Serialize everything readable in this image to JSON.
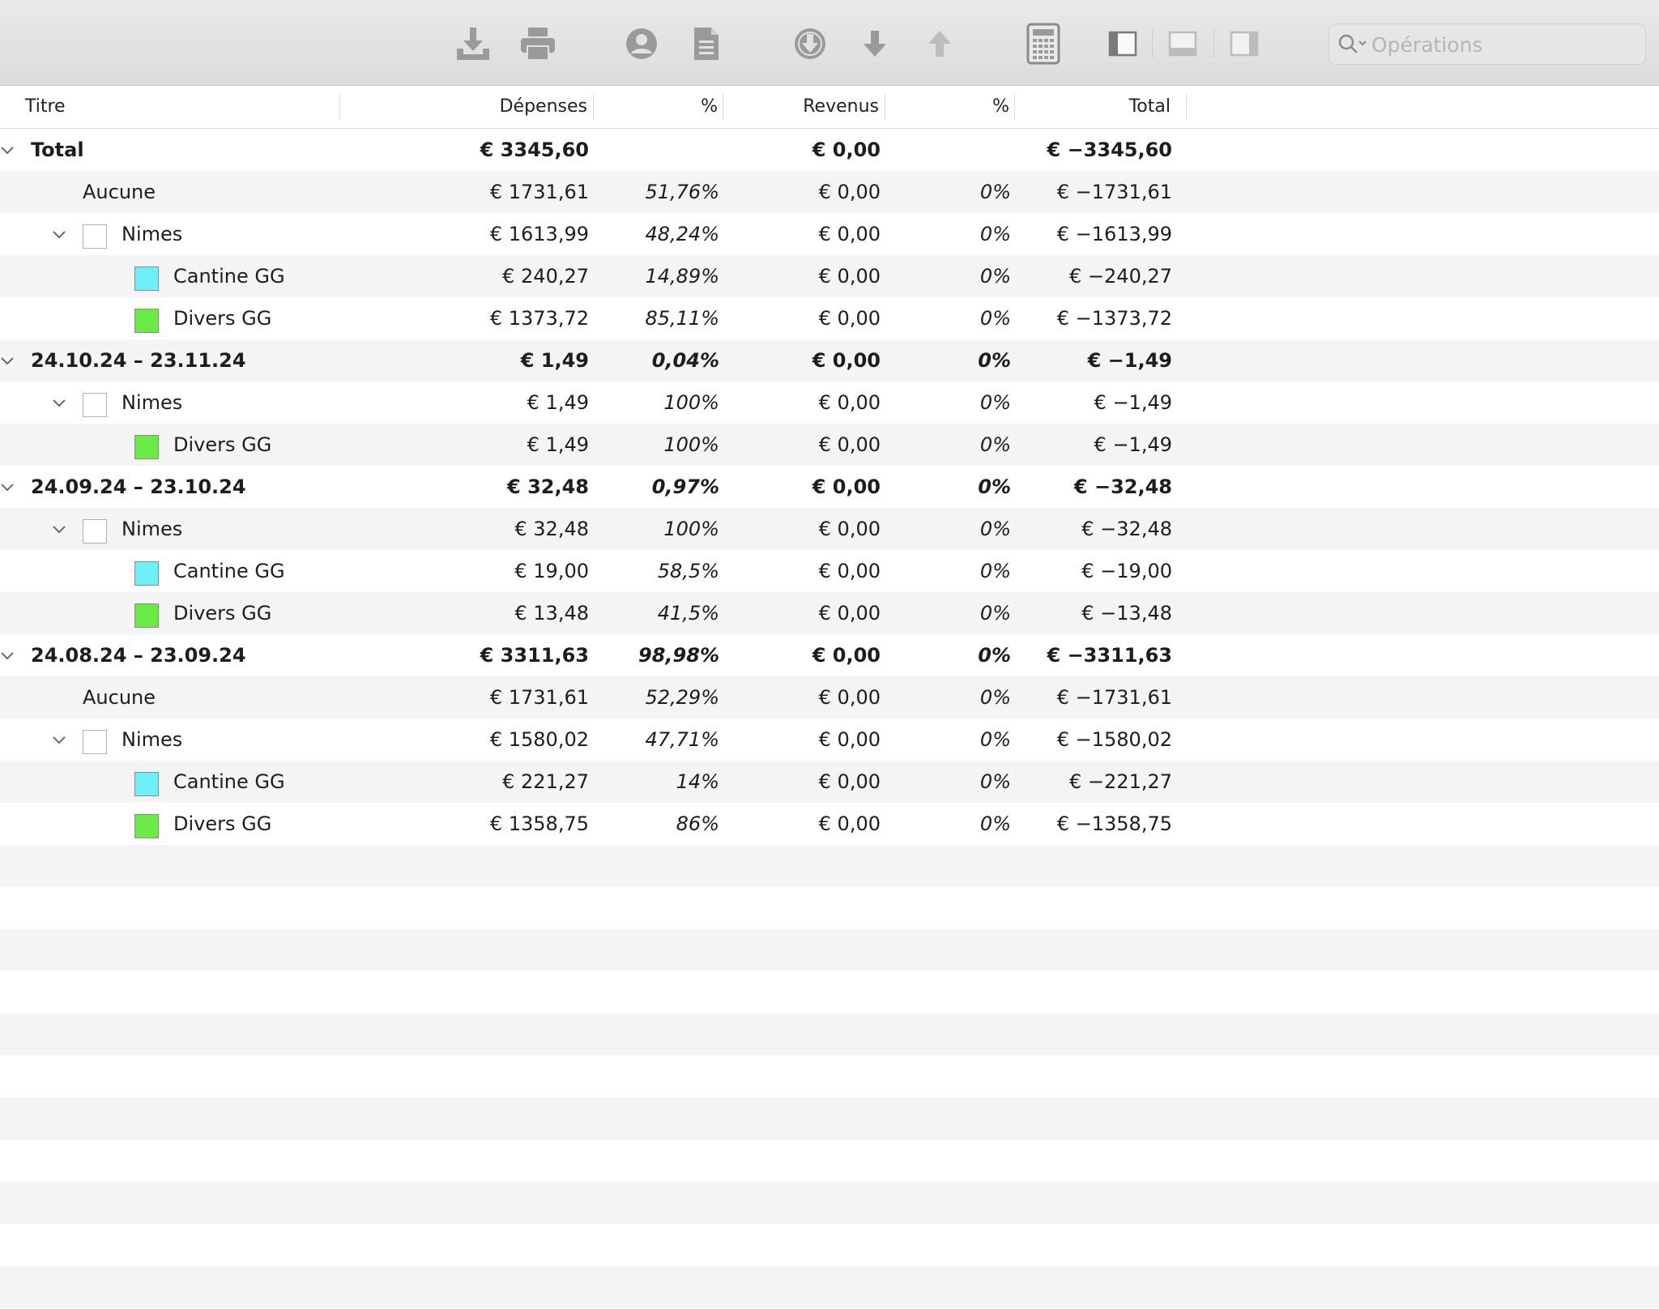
{
  "toolbar": {
    "buttons": [
      {
        "name": "export-icon"
      },
      {
        "name": "print-icon"
      },
      {
        "name": "account-icon"
      },
      {
        "name": "document-icon"
      },
      {
        "name": "download-circle-icon"
      },
      {
        "name": "arrow-down-icon"
      },
      {
        "name": "arrow-up-icon"
      },
      {
        "name": "calculator-icon"
      },
      {
        "name": "sidebar-left-icon"
      },
      {
        "name": "panel-bottom-icon"
      },
      {
        "name": "sidebar-right-icon"
      }
    ],
    "search_placeholder": "Opérations"
  },
  "columns": [
    "Titre",
    "Dépenses",
    "%",
    "Revenus",
    "%",
    "Total"
  ],
  "colors": {
    "cyan": "#6ef0fb",
    "green": "#6bea45",
    "white": "#ffffff"
  },
  "rows": [
    {
      "level": 0,
      "expandable": true,
      "bold": true,
      "title": "Total",
      "depenses": "€ 3345,60",
      "pct1": "",
      "revenus": "€ 0,00",
      "pct2": "",
      "total": "€ −3345,60"
    },
    {
      "level": 1,
      "expandable": false,
      "bold": false,
      "title": "Aucune",
      "depenses": "€ 1731,61",
      "pct1": "51,76%",
      "revenus": "€ 0,00",
      "pct2": "0%",
      "total": "€ −1731,61"
    },
    {
      "level": 1,
      "expandable": true,
      "bold": false,
      "swatch": "white",
      "title": "Nimes",
      "depenses": "€ 1613,99",
      "pct1": "48,24%",
      "revenus": "€ 0,00",
      "pct2": "0%",
      "total": "€ −1613,99"
    },
    {
      "level": 2,
      "expandable": false,
      "bold": false,
      "swatch": "cyan",
      "title": "Cantine GG",
      "depenses": "€ 240,27",
      "pct1": "14,89%",
      "revenus": "€ 0,00",
      "pct2": "0%",
      "total": "€ −240,27"
    },
    {
      "level": 2,
      "expandable": false,
      "bold": false,
      "swatch": "green",
      "title": "Divers GG",
      "depenses": "€ 1373,72",
      "pct1": "85,11%",
      "revenus": "€ 0,00",
      "pct2": "0%",
      "total": "€ −1373,72"
    },
    {
      "level": 0,
      "expandable": true,
      "bold": true,
      "title": "24.10.24 – 23.11.24",
      "depenses": "€ 1,49",
      "pct1": "0,04%",
      "revenus": "€ 0,00",
      "pct2": "0%",
      "total": "€ −1,49"
    },
    {
      "level": 1,
      "expandable": true,
      "bold": false,
      "swatch": "white",
      "title": "Nimes",
      "depenses": "€ 1,49",
      "pct1": "100%",
      "revenus": "€ 0,00",
      "pct2": "0%",
      "total": "€ −1,49"
    },
    {
      "level": 2,
      "expandable": false,
      "bold": false,
      "swatch": "green",
      "title": "Divers GG",
      "depenses": "€ 1,49",
      "pct1": "100%",
      "revenus": "€ 0,00",
      "pct2": "0%",
      "total": "€ −1,49"
    },
    {
      "level": 0,
      "expandable": true,
      "bold": true,
      "title": "24.09.24 – 23.10.24",
      "depenses": "€ 32,48",
      "pct1": "0,97%",
      "revenus": "€ 0,00",
      "pct2": "0%",
      "total": "€ −32,48"
    },
    {
      "level": 1,
      "expandable": true,
      "bold": false,
      "swatch": "white",
      "title": "Nimes",
      "depenses": "€ 32,48",
      "pct1": "100%",
      "revenus": "€ 0,00",
      "pct2": "0%",
      "total": "€ −32,48"
    },
    {
      "level": 2,
      "expandable": false,
      "bold": false,
      "swatch": "cyan",
      "title": "Cantine GG",
      "depenses": "€ 19,00",
      "pct1": "58,5%",
      "revenus": "€ 0,00",
      "pct2": "0%",
      "total": "€ −19,00"
    },
    {
      "level": 2,
      "expandable": false,
      "bold": false,
      "swatch": "green",
      "title": "Divers GG",
      "depenses": "€ 13,48",
      "pct1": "41,5%",
      "revenus": "€ 0,00",
      "pct2": "0%",
      "total": "€ −13,48"
    },
    {
      "level": 0,
      "expandable": true,
      "bold": true,
      "title": "24.08.24 – 23.09.24",
      "depenses": "€ 3311,63",
      "pct1": "98,98%",
      "revenus": "€ 0,00",
      "pct2": "0%",
      "total": "€ −3311,63"
    },
    {
      "level": 1,
      "expandable": false,
      "bold": false,
      "title": "Aucune",
      "depenses": "€ 1731,61",
      "pct1": "52,29%",
      "revenus": "€ 0,00",
      "pct2": "0%",
      "total": "€ −1731,61"
    },
    {
      "level": 1,
      "expandable": true,
      "bold": false,
      "swatch": "white",
      "title": "Nimes",
      "depenses": "€ 1580,02",
      "pct1": "47,71%",
      "revenus": "€ 0,00",
      "pct2": "0%",
      "total": "€ −1580,02"
    },
    {
      "level": 2,
      "expandable": false,
      "bold": false,
      "swatch": "cyan",
      "title": "Cantine GG",
      "depenses": "€ 221,27",
      "pct1": "14%",
      "revenus": "€ 0,00",
      "pct2": "0%",
      "total": "€ −221,27"
    },
    {
      "level": 2,
      "expandable": false,
      "bold": false,
      "swatch": "green",
      "title": "Divers GG",
      "depenses": "€ 1358,75",
      "pct1": "86%",
      "revenus": "€ 0,00",
      "pct2": "0%",
      "total": "€ −1358,75"
    }
  ]
}
